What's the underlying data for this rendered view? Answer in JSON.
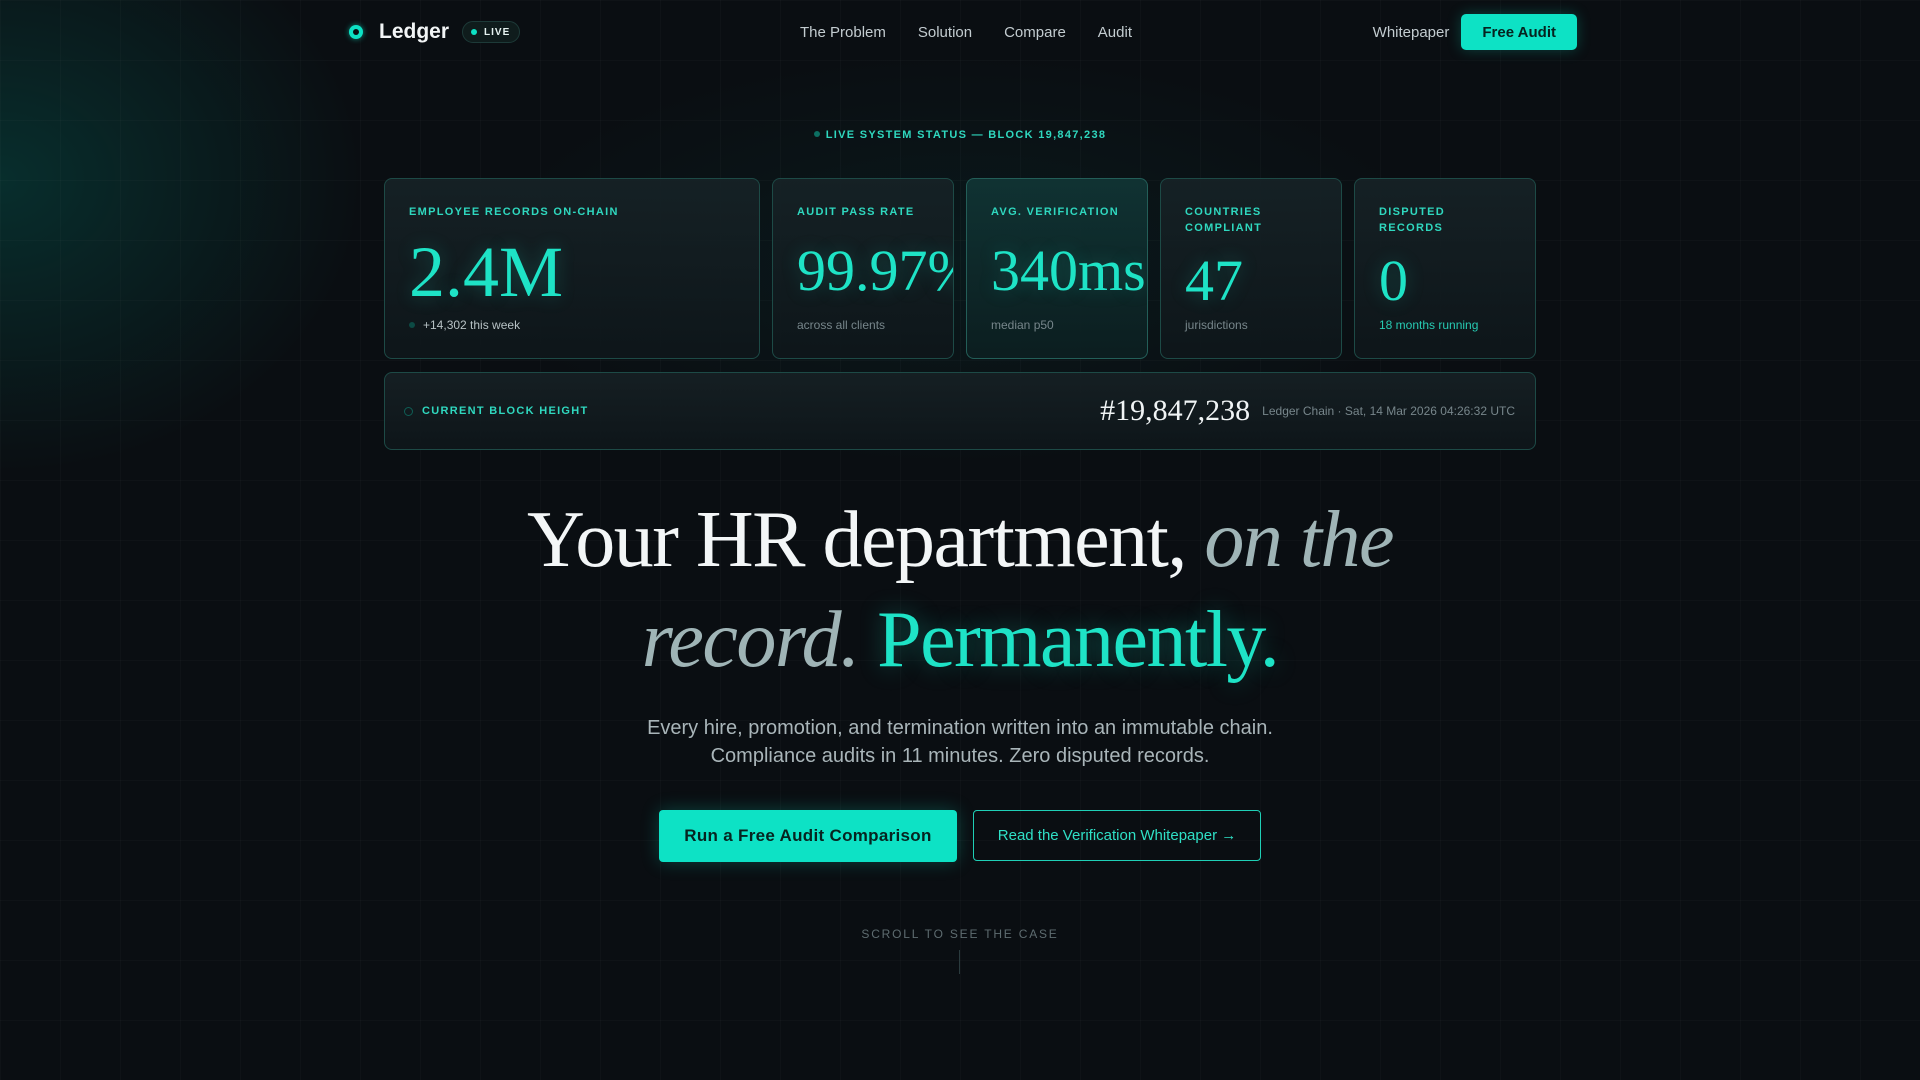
{
  "nav": {
    "brand": "Ledger",
    "live_badge": "LIVE",
    "links": [
      "The Problem",
      "Solution",
      "Compare",
      "Audit"
    ],
    "whitepaper": "Whitepaper",
    "cta": "Free Audit"
  },
  "status_line": "LIVE SYSTEM STATUS — BLOCK 19,847,238",
  "stats": [
    {
      "label": "EMPLOYEE RECORDS ON-CHAIN",
      "value": "2.4M",
      "sub": "+14,302 this week"
    },
    {
      "label": "AUDIT PASS RATE",
      "value": "99.97%",
      "sub": "across all clients"
    },
    {
      "label": "AVG. VERIFICATION",
      "value": "340ms",
      "sub": "median p50"
    },
    {
      "label": "COUNTRIES COMPLIANT",
      "value": "47",
      "sub": "jurisdictions"
    },
    {
      "label": "DISPUTED RECORDS",
      "value": "0",
      "sub": "18 months running"
    }
  ],
  "block": {
    "label": "CURRENT BLOCK HEIGHT",
    "number": "#19,847,238",
    "meta": "Ledger Chain · Sat, 14 Mar 2026 04:26:32 UTC"
  },
  "hero": {
    "title_plain": "Your HR department, ",
    "title_italic_1": "on the",
    "title_italic_2": "record.",
    "title_accent": "Permanently.",
    "subtitle_line1": "Every hire, promotion, and termination written into an immutable chain.",
    "subtitle_line2": "Compliance audits in 11 minutes. Zero disputed records."
  },
  "ctas": {
    "primary": "Run a Free Audit Comparison",
    "secondary": "Read the Verification Whitepaper →"
  },
  "scroll_hint": "SCROLL TO SEE THE CASE",
  "colors": {
    "accent": "#0de2c5",
    "background": "#0a0e12",
    "card_border": "#1d4a46"
  },
  "icons": {
    "brand": "ledger-logo-icon",
    "live": "live-dot-icon",
    "status": "status-dot-icon",
    "trend": "trend-up-icon",
    "block": "block-dot-icon"
  }
}
